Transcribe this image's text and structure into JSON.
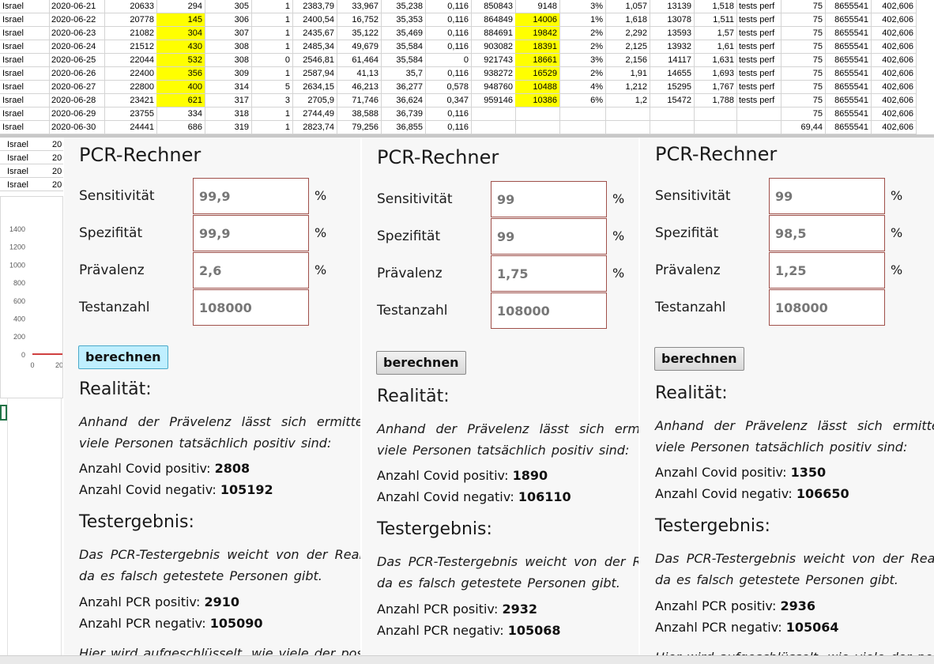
{
  "sheet": {
    "rows": [
      {
        "country": "Israel",
        "date": "2020-06-21",
        "c": "20633",
        "d": "294",
        "e": "305",
        "f": "1",
        "g": "2383,79",
        "h": "33,967",
        "i": "35,238",
        "j": "0,116",
        "k": "850843",
        "l": "9148",
        "m": "3%",
        "n": "1,057",
        "o": "13139",
        "p": "1,518",
        "q": "tests perf",
        "r": "75",
        "s": "8655541",
        "t": "402,606",
        "hl": false
      },
      {
        "country": "Israel",
        "date": "2020-06-22",
        "c": "20778",
        "d": "145",
        "e": "306",
        "f": "1",
        "g": "2400,54",
        "h": "16,752",
        "i": "35,353",
        "j": "0,116",
        "k": "864849",
        "l": "14006",
        "m": "1%",
        "n": "1,618",
        "o": "13078",
        "p": "1,511",
        "q": "tests perf",
        "r": "75",
        "s": "8655541",
        "t": "402,606",
        "hl": true
      },
      {
        "country": "Israel",
        "date": "2020-06-23",
        "c": "21082",
        "d": "304",
        "e": "307",
        "f": "1",
        "g": "2435,67",
        "h": "35,122",
        "i": "35,469",
        "j": "0,116",
        "k": "884691",
        "l": "19842",
        "m": "2%",
        "n": "2,292",
        "o": "13593",
        "p": "1,57",
        "q": "tests perf",
        "r": "75",
        "s": "8655541",
        "t": "402,606",
        "hl": true
      },
      {
        "country": "Israel",
        "date": "2020-06-24",
        "c": "21512",
        "d": "430",
        "e": "308",
        "f": "1",
        "g": "2485,34",
        "h": "49,679",
        "i": "35,584",
        "j": "0,116",
        "k": "903082",
        "l": "18391",
        "m": "2%",
        "n": "2,125",
        "o": "13932",
        "p": "1,61",
        "q": "tests perf",
        "r": "75",
        "s": "8655541",
        "t": "402,606",
        "hl": true
      },
      {
        "country": "Israel",
        "date": "2020-06-25",
        "c": "22044",
        "d": "532",
        "e": "308",
        "f": "0",
        "g": "2546,81",
        "h": "61,464",
        "i": "35,584",
        "j": "0",
        "k": "921743",
        "l": "18661",
        "m": "3%",
        "n": "2,156",
        "o": "14117",
        "p": "1,631",
        "q": "tests perf",
        "r": "75",
        "s": "8655541",
        "t": "402,606",
        "hl": true
      },
      {
        "country": "Israel",
        "date": "2020-06-26",
        "c": "22400",
        "d": "356",
        "e": "309",
        "f": "1",
        "g": "2587,94",
        "h": "41,13",
        "i": "35,7",
        "j": "0,116",
        "k": "938272",
        "l": "16529",
        "m": "2%",
        "n": "1,91",
        "o": "14655",
        "p": "1,693",
        "q": "tests perf",
        "r": "75",
        "s": "8655541",
        "t": "402,606",
        "hl": true
      },
      {
        "country": "Israel",
        "date": "2020-06-27",
        "c": "22800",
        "d": "400",
        "e": "314",
        "f": "5",
        "g": "2634,15",
        "h": "46,213",
        "i": "36,277",
        "j": "0,578",
        "k": "948760",
        "l": "10488",
        "m": "4%",
        "n": "1,212",
        "o": "15295",
        "p": "1,767",
        "q": "tests perf",
        "r": "75",
        "s": "8655541",
        "t": "402,606",
        "hl": true
      },
      {
        "country": "Israel",
        "date": "2020-06-28",
        "c": "23421",
        "d": "621",
        "e": "317",
        "f": "3",
        "g": "2705,9",
        "h": "71,746",
        "i": "36,624",
        "j": "0,347",
        "k": "959146",
        "l": "10386",
        "m": "6%",
        "n": "1,2",
        "o": "15472",
        "p": "1,788",
        "q": "tests perf",
        "r": "75",
        "s": "8655541",
        "t": "402,606",
        "hl": true
      },
      {
        "country": "Israel",
        "date": "2020-06-29",
        "c": "23755",
        "d": "334",
        "e": "318",
        "f": "1",
        "g": "2744,49",
        "h": "38,588",
        "i": "36,739",
        "j": "0,116",
        "k": "",
        "l": "",
        "m": "",
        "n": "",
        "o": "",
        "p": "",
        "q": "",
        "r": "75",
        "s": "8655541",
        "t": "402,606",
        "hl": false
      },
      {
        "country": "Israel",
        "date": "2020-06-30",
        "c": "24441",
        "d": "686",
        "e": "319",
        "f": "1",
        "g": "2823,74",
        "h": "79,256",
        "i": "36,855",
        "j": "0,116",
        "k": "",
        "l": "",
        "m": "",
        "n": "",
        "o": "",
        "p": "",
        "q": "",
        "r": "69,44",
        "s": "8655541",
        "t": "402,606",
        "hl": false
      }
    ],
    "left_rows": [
      {
        "country": "Israel",
        "date": "20"
      },
      {
        "country": "Israel",
        "date": "20"
      },
      {
        "country": "Israel",
        "date": "20"
      },
      {
        "country": "Israel",
        "date": "20"
      }
    ],
    "chart_y_ticks": [
      "1400",
      "1200",
      "1000",
      "800",
      "600",
      "400",
      "200",
      "0"
    ],
    "chart_x_ticks": [
      "0",
      "20"
    ]
  },
  "labels": {
    "title": "PCR-Rechner",
    "sens": "Sensitivität",
    "spez": "Spezifität",
    "prev": "Prävalenz",
    "tests": "Testanzahl",
    "pct": "%",
    "button": "berechnen",
    "realitaet": "Realität:",
    "realitaet_text": "Anhand der Prävelenz lässt sich ermitteln, wie viele Personen tatsächlich positiv sind:",
    "covid_pos": "Anzahl Covid positiv:",
    "covid_neg": "Anzahl Covid negativ:",
    "testergebnis": "Testergebnis:",
    "testergebnis_text": "Das PCR-Testergebnis weicht von der Realität ab, da es falsch getestete Personen gibt.",
    "pcr_pos": "Anzahl PCR positiv:",
    "pcr_neg": "Anzahl PCR negativ:",
    "footer_text": "Hier wird aufgeschlüsselt, wie viele der positiven"
  },
  "panels": [
    {
      "sens": "99,9",
      "spez": "99,9",
      "prev": "2,6",
      "tests": "108000",
      "covid_pos": "2808",
      "covid_neg": "105192",
      "pcr_pos": "2910",
      "pcr_neg": "105090"
    },
    {
      "sens": "99",
      "spez": "99",
      "prev": "1,75",
      "tests": "108000",
      "covid_pos": "1890",
      "covid_neg": "106110",
      "pcr_pos": "2932",
      "pcr_neg": "105068"
    },
    {
      "sens": "99",
      "spez": "98,5",
      "prev": "1,25",
      "tests": "108000",
      "covid_pos": "1350",
      "covid_neg": "106650",
      "pcr_pos": "2936",
      "pcr_neg": "105064"
    }
  ],
  "colors": {
    "highlight": "#ffff00",
    "active_button": "#bfefff",
    "input_border": "#a0504a"
  }
}
